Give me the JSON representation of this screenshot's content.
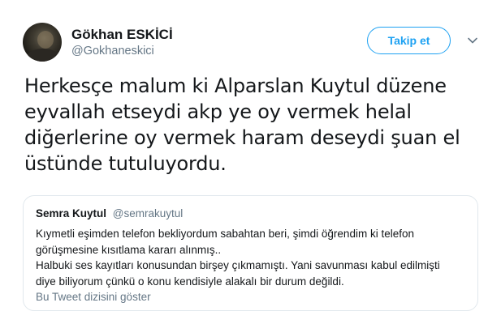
{
  "author": {
    "name": "Gökhan ESKİCİ",
    "handle": "@Gokhaneskici"
  },
  "follow_button": {
    "label": "Takip et"
  },
  "menu": {
    "icon": "chevron-down-icon"
  },
  "tweet": {
    "lines": [
      "Herkesçe malum ki Alparslan Kuytul düzene",
      "eyvallah etseydi akp ye oy vermek helal",
      "diğerlerine oy vermek haram deseydi şuan el",
      "üstünde tutuluyordu."
    ]
  },
  "quoted_tweet": {
    "name": "Semra Kuytul",
    "handle": "@semrakuytul",
    "lines": [
      "Kıymetli eşimden telefon bekliyordum sabahtan beri, şimdi öğrendim ki telefon",
      "görüşmesine kısıtlama kararı alınmış..",
      "Halbuki ses kayıtları konusundan birşey çıkmamıştı. Yani savunması kabul edilmişti",
      "diye biliyorum çünkü o konu kendisiyle alakalı bir durum değildi."
    ],
    "thread_link": "Bu Tweet dizisini göster"
  },
  "colors": {
    "accent": "#1da1f2",
    "text": "#14171a",
    "secondary_text": "#657786",
    "border": "#e1e8ed"
  }
}
